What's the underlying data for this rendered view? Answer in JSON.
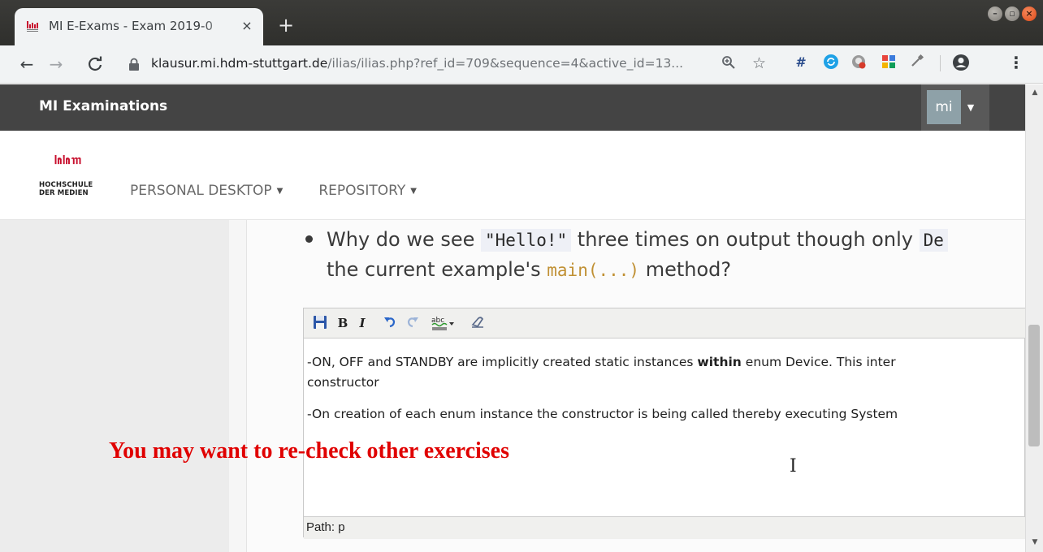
{
  "browser": {
    "tab_title": "MI E-Exams - Exam 2019-0",
    "tab_close": "×",
    "new_tab": "+",
    "url_host": "klausur.mi.hdm-stuttgart.de",
    "url_path": "/ilias/ilias.php?ref_id=709&sequence=4&active_id=13...",
    "ext_hash": "#"
  },
  "topbar": {
    "brand": "MI Examinations",
    "user_avatar": "mi"
  },
  "header": {
    "logo_line1": "HOCHSCHULE",
    "logo_line2": "DER MEDIEN",
    "nav": [
      {
        "label": "PERSONAL DESKTOP"
      },
      {
        "label": "REPOSITORY"
      }
    ]
  },
  "question": {
    "line1_prefix": "Why do we see ",
    "line1_code": "\"Hello!\"",
    "line1_middle": " three times on output though only ",
    "line1_code2": "De",
    "line2_prefix": "the current example's ",
    "line2_code": "main(...)",
    "line2_suffix": " method?"
  },
  "editor": {
    "toolbar": {
      "bold": "B",
      "italic": "I"
    },
    "paragraph1_before": "-ON, OFF and STANDBY are implicitly created static instances ",
    "paragraph1_bold": "within",
    "paragraph1_after": " enum Device. This inter",
    "paragraph1_line2": "constructor",
    "paragraph2": "-On creation of each enum instance the constructor is being called thereby executing System",
    "status": "Path: p"
  },
  "overlay": {
    "message": "You may want to re-check other exercises"
  },
  "colors": {
    "topbar_bg": "#444444",
    "logo_red": "#c8102e",
    "overlay_red": "#e00000"
  }
}
